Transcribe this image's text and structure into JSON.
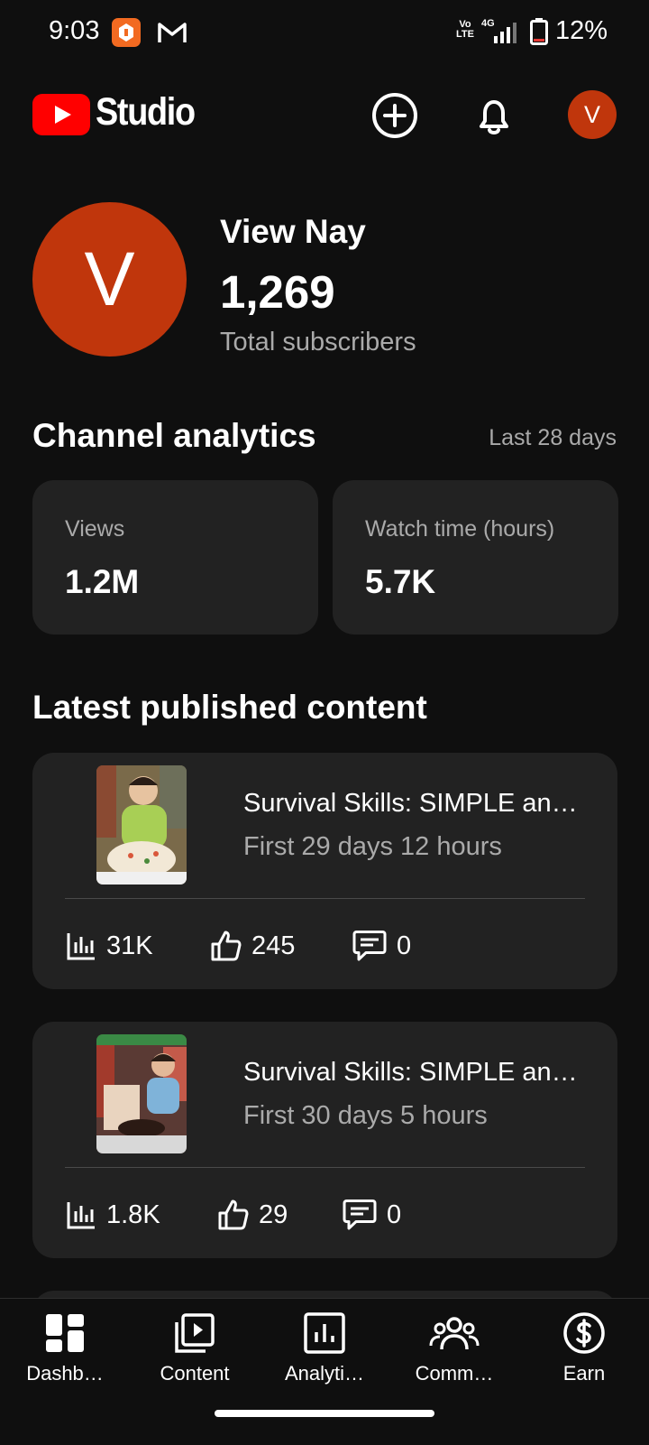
{
  "status_bar": {
    "time": "9:03",
    "volte": "Vo LTE",
    "network": "4G",
    "battery_pct": "12%",
    "battery_level": 0.12
  },
  "header": {
    "logo_text": "Studio",
    "avatar_initial": "V",
    "accent": "#ff0000"
  },
  "channel": {
    "avatar_initial": "V",
    "name": "View Nay",
    "subscribers": "1,269",
    "subscribers_label": "Total subscribers",
    "avatar_color": "#c0360c"
  },
  "analytics": {
    "title": "Channel analytics",
    "range": "Last 28 days",
    "metrics": [
      {
        "label": "Views",
        "value": "1.2M"
      },
      {
        "label": "Watch time (hours)",
        "value": "5.7K"
      }
    ]
  },
  "latest": {
    "title": "Latest published content",
    "items": [
      {
        "title": "Survival Skills: SIMPLE  and USEFUL",
        "subtitle": "First 29 days 12 hours",
        "views": "31K",
        "likes": "245",
        "comments": "0"
      },
      {
        "title": "Survival Skills: SIMPLE  and USEFUL",
        "subtitle": "First 30 days 5 hours",
        "views": "1.8K",
        "likes": "29",
        "comments": "0"
      }
    ]
  },
  "nav": {
    "items": [
      {
        "label": "Dashb…",
        "icon": "dashboard-icon"
      },
      {
        "label": "Content",
        "icon": "content-icon"
      },
      {
        "label": "Analyti…",
        "icon": "analytics-icon"
      },
      {
        "label": "Comm…",
        "icon": "community-icon"
      },
      {
        "label": "Earn",
        "icon": "earn-icon"
      }
    ]
  }
}
